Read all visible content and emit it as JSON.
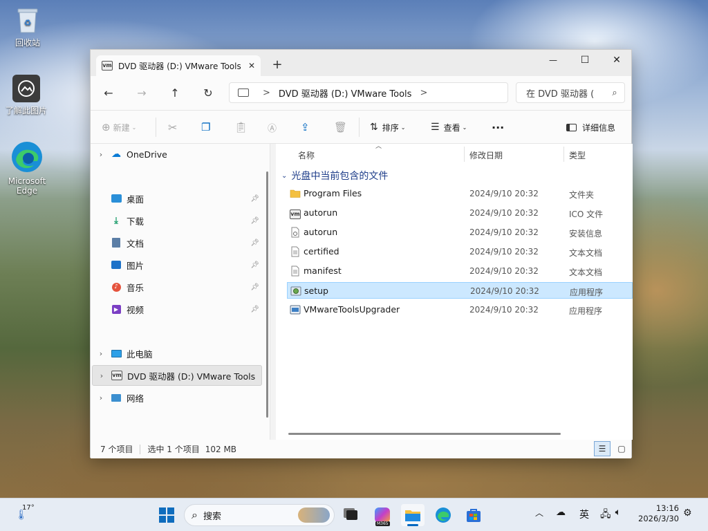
{
  "desktop": {
    "icons": [
      {
        "label": "回收站",
        "icon": "recycle-bin-icon"
      },
      {
        "label": "了解此图片",
        "icon": "learn-image-icon"
      },
      {
        "label": "Microsoft Edge",
        "icon": "edge-icon"
      }
    ]
  },
  "window": {
    "tab_title": "DVD 驱动器 (D:) VMware Tools",
    "new_tab": "+",
    "close_tab": "✕",
    "controls": {
      "minimize": "—",
      "maximize": "☐",
      "close": "✕"
    },
    "address": {
      "segments": [
        "DVD 驱动器 (D:) VMware Tools"
      ],
      "sep": ">"
    },
    "search_placeholder": "在 DVD 驱动器 (",
    "toolbar": {
      "new": "新建",
      "sort": "排序",
      "view": "查看",
      "more": "···",
      "details": "详细信息"
    },
    "nav": {
      "onedrive": "OneDrive",
      "quick": [
        "桌面",
        "下载",
        "文档",
        "图片",
        "音乐",
        "视频"
      ],
      "this_pc": "此电脑",
      "dvd": "DVD 驱动器 (D:) VMware Tools",
      "network": "网络"
    },
    "columns": {
      "name": "名称",
      "date": "修改日期",
      "type": "类型"
    },
    "group_title": "光盘中当前包含的文件",
    "files": [
      {
        "name": "Program Files",
        "date": "2024/9/10 20:32",
        "type": "文件夹",
        "icon": "folder-icon"
      },
      {
        "name": "autorun",
        "date": "2024/9/10 20:32",
        "type": "ICO 文件",
        "icon": "vmware-icon"
      },
      {
        "name": "autorun",
        "date": "2024/9/10 20:32",
        "type": "安装信息",
        "icon": "setup-info-icon"
      },
      {
        "name": "certified",
        "date": "2024/9/10 20:32",
        "type": "文本文档",
        "icon": "text-file-icon"
      },
      {
        "name": "manifest",
        "date": "2024/9/10 20:32",
        "type": "文本文档",
        "icon": "text-file-icon"
      },
      {
        "name": "setup",
        "date": "2024/9/10 20:32",
        "type": "应用程序",
        "icon": "setup-exe-icon",
        "selected": true
      },
      {
        "name": "VMwareToolsUpgrader",
        "date": "2024/9/10 20:32",
        "type": "应用程序",
        "icon": "vmware-app-icon"
      }
    ],
    "status": {
      "count": "7 个项目",
      "selected": "选中 1 个项目",
      "size": "102 MB"
    }
  },
  "taskbar": {
    "weather": "17°",
    "search": "搜索",
    "ime": "英",
    "time": "13:16",
    "date": "2026/3/30",
    "m365": "M365"
  },
  "colors": {
    "selection": "#cce8ff",
    "selection_border": "#99d1ff",
    "accent": "#0067c0"
  }
}
